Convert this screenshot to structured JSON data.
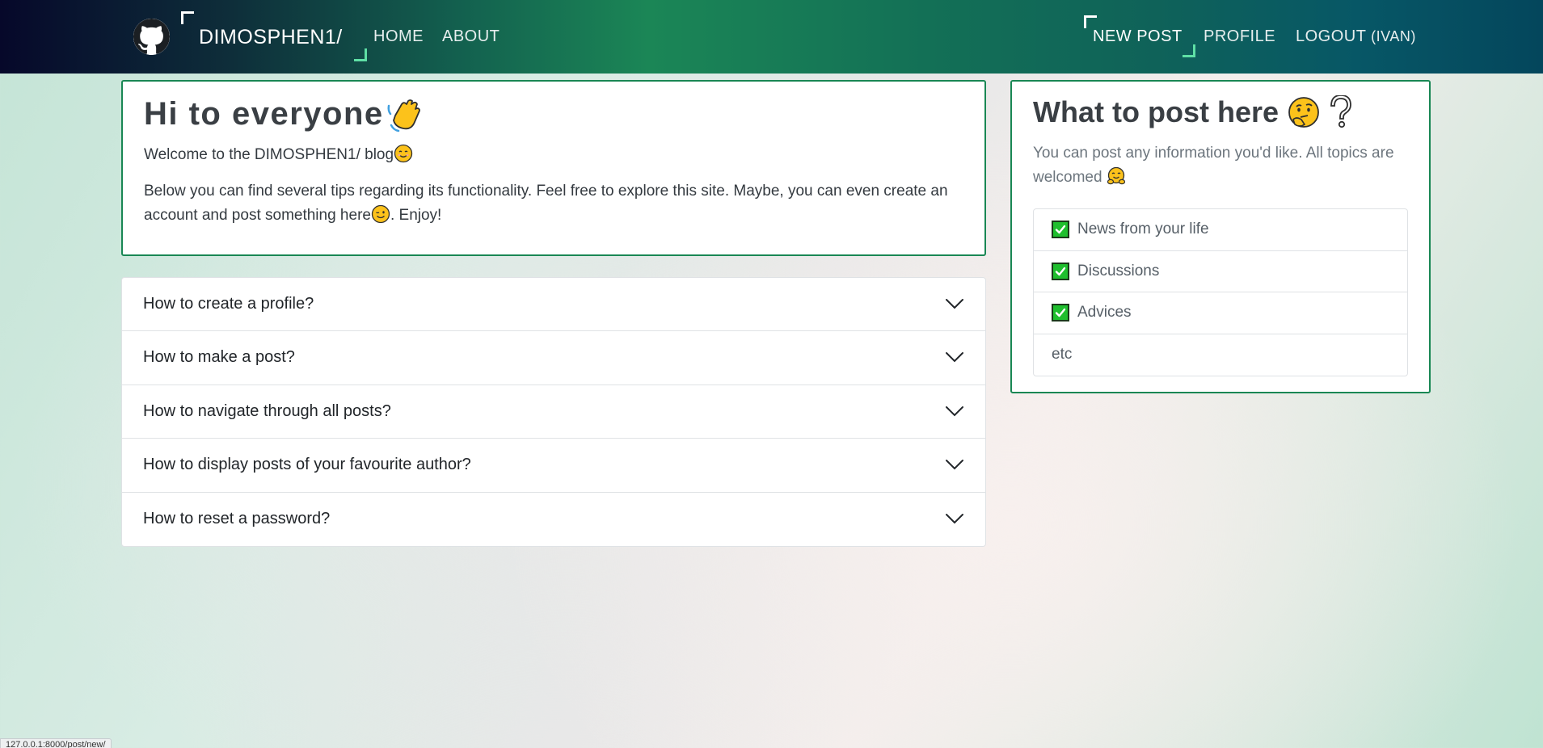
{
  "nav": {
    "brand": "DIMOSPHEN1/",
    "home": "HOME",
    "about": "ABOUT",
    "new_post": "NEW POST",
    "profile": "PROFILE",
    "logout": "LOGOUT",
    "logout_user": "(IVAN)"
  },
  "welcome": {
    "title": "Hi to everyone",
    "line_prefix": "Welcome to the DIMOSPHEN1/ blog",
    "para_part1": "Below you can find several tips regarding its functionality. Feel free to explore this site. Maybe, you can even create an account and post something here",
    "para_part2": ". Enjoy!"
  },
  "faq": [
    {
      "question": "How to create a profile?"
    },
    {
      "question": "How to make a post?"
    },
    {
      "question": "How to navigate through all posts?"
    },
    {
      "question": "How to display posts of your favourite author?"
    },
    {
      "question": "How to reset a password?"
    }
  ],
  "side": {
    "title": "What to post here",
    "desc": "You can post any information you'd like. All topics are welcomed",
    "topics": [
      {
        "label": "News from your life",
        "checked": true
      },
      {
        "label": "Discussions",
        "checked": true
      },
      {
        "label": "Advices",
        "checked": true
      },
      {
        "label": "etc",
        "checked": false
      }
    ]
  },
  "status_url": "127.0.0.1:8000/post/new/",
  "colors": {
    "accent_green": "#198754",
    "check_green": "#1fbf2e",
    "nav_text": "#ffffff"
  }
}
